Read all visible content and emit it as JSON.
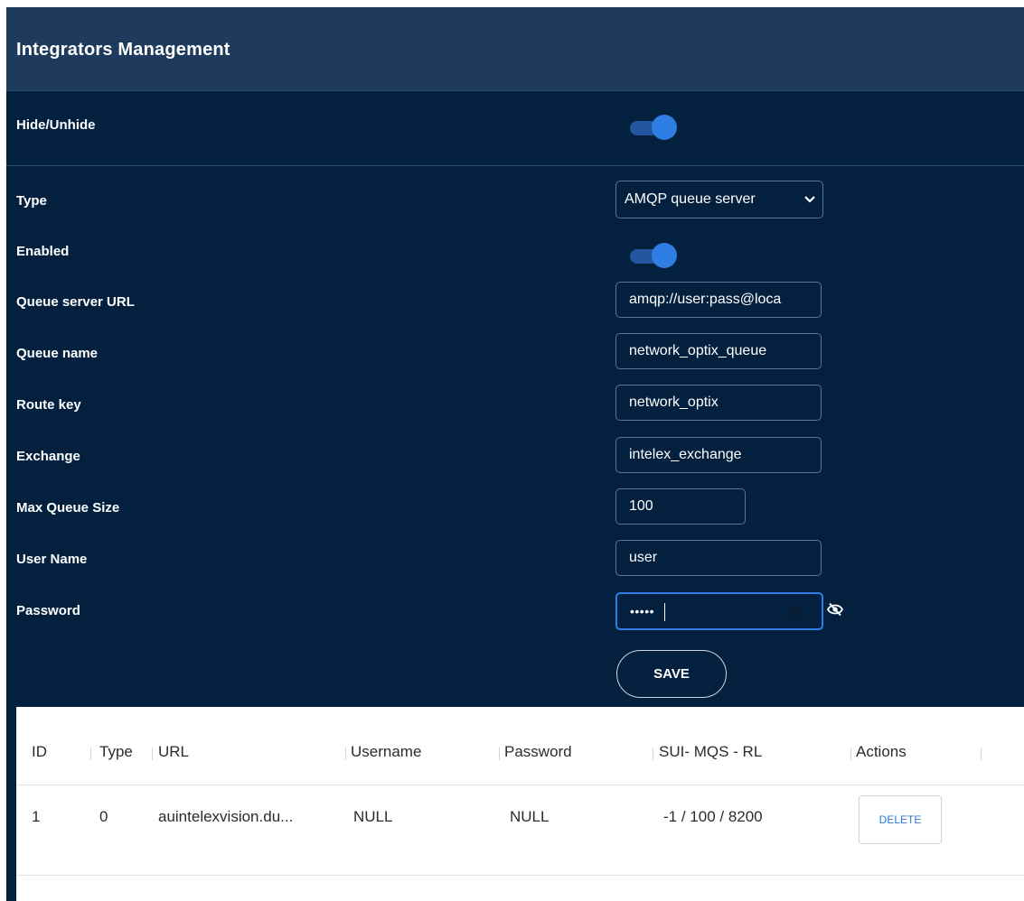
{
  "header": {
    "title": "Integrators Management"
  },
  "hide_unhide": {
    "label": "Hide/Unhide",
    "toggle_state": "on"
  },
  "form": {
    "type": {
      "label": "Type",
      "value": "AMQP queue server"
    },
    "enabled": {
      "label": "Enabled",
      "toggle_state": "on"
    },
    "queue_server_url": {
      "label": "Queue server URL",
      "value": "amqp://user:pass@loca"
    },
    "queue_name": {
      "label": "Queue name",
      "value": "network_optix_queue"
    },
    "route_key": {
      "label": "Route key",
      "value": "network_optix"
    },
    "exchange": {
      "label": "Exchange",
      "value": "intelex_exchange"
    },
    "max_queue_size": {
      "label": "Max Queue Size",
      "value": "100"
    },
    "user_name": {
      "label": "User Name",
      "value": "user"
    },
    "password": {
      "label": "Password",
      "masked_value": "•••••"
    },
    "save_label": "SAVE"
  },
  "table": {
    "headers": [
      "ID",
      "Type",
      "URL",
      "Username",
      "Password",
      "SUI- MQS - RL",
      "Actions"
    ],
    "rows": [
      {
        "id": "1",
        "type": "0",
        "url": "auintelexvision.du...",
        "username": "NULL",
        "password": "NULL",
        "sui_mqs_rl": "-1 / 100 / 8200",
        "action_label": "DELETE"
      }
    ]
  },
  "icons": {
    "toggle": "toggle-switch",
    "dropdown": "chevron-down-icon",
    "show_password": "eye-icon",
    "hide_password": "eye-off-icon"
  },
  "colors": {
    "panel_background": "#03203f",
    "header_background": "#1e3a5c",
    "accent": "#2f7ee6",
    "delete_text": "#2b78d6"
  }
}
